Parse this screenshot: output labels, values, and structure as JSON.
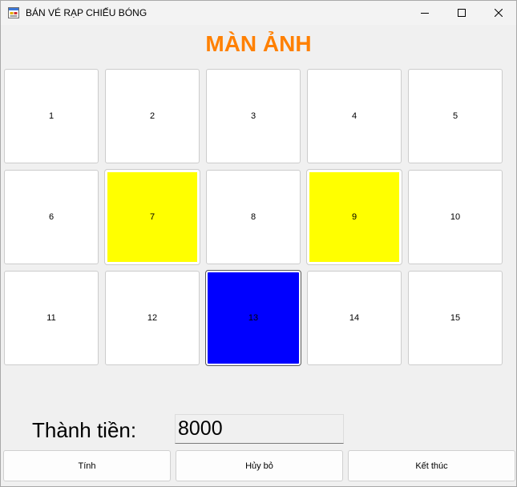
{
  "window": {
    "title": "BÁN VÉ RẠP CHIẾU BÓNG",
    "icon": "winforms-app-icon",
    "controls": [
      "minimize-icon",
      "maximize-icon",
      "close-icon"
    ]
  },
  "screen_label": "MÀN ẢNH",
  "seats": [
    {
      "number": "1",
      "state": "available"
    },
    {
      "number": "2",
      "state": "available"
    },
    {
      "number": "3",
      "state": "available"
    },
    {
      "number": "4",
      "state": "available"
    },
    {
      "number": "5",
      "state": "available"
    },
    {
      "number": "6",
      "state": "available"
    },
    {
      "number": "7",
      "state": "selected"
    },
    {
      "number": "8",
      "state": "available"
    },
    {
      "number": "9",
      "state": "selected"
    },
    {
      "number": "10",
      "state": "available"
    },
    {
      "number": "11",
      "state": "available"
    },
    {
      "number": "12",
      "state": "available"
    },
    {
      "number": "13",
      "state": "sold"
    },
    {
      "number": "14",
      "state": "available"
    },
    {
      "number": "15",
      "state": "available"
    }
  ],
  "seat_colors": {
    "available": "#ffffff",
    "selected": "#ffff00",
    "sold": "#0000ff"
  },
  "total": {
    "label": "Thành tiền:",
    "value": "8000"
  },
  "buttons": {
    "calculate": "Tính",
    "cancel": "Hủy bỏ",
    "exit": "Kết thúc"
  },
  "colors": {
    "screen_label": "#ff8000"
  }
}
